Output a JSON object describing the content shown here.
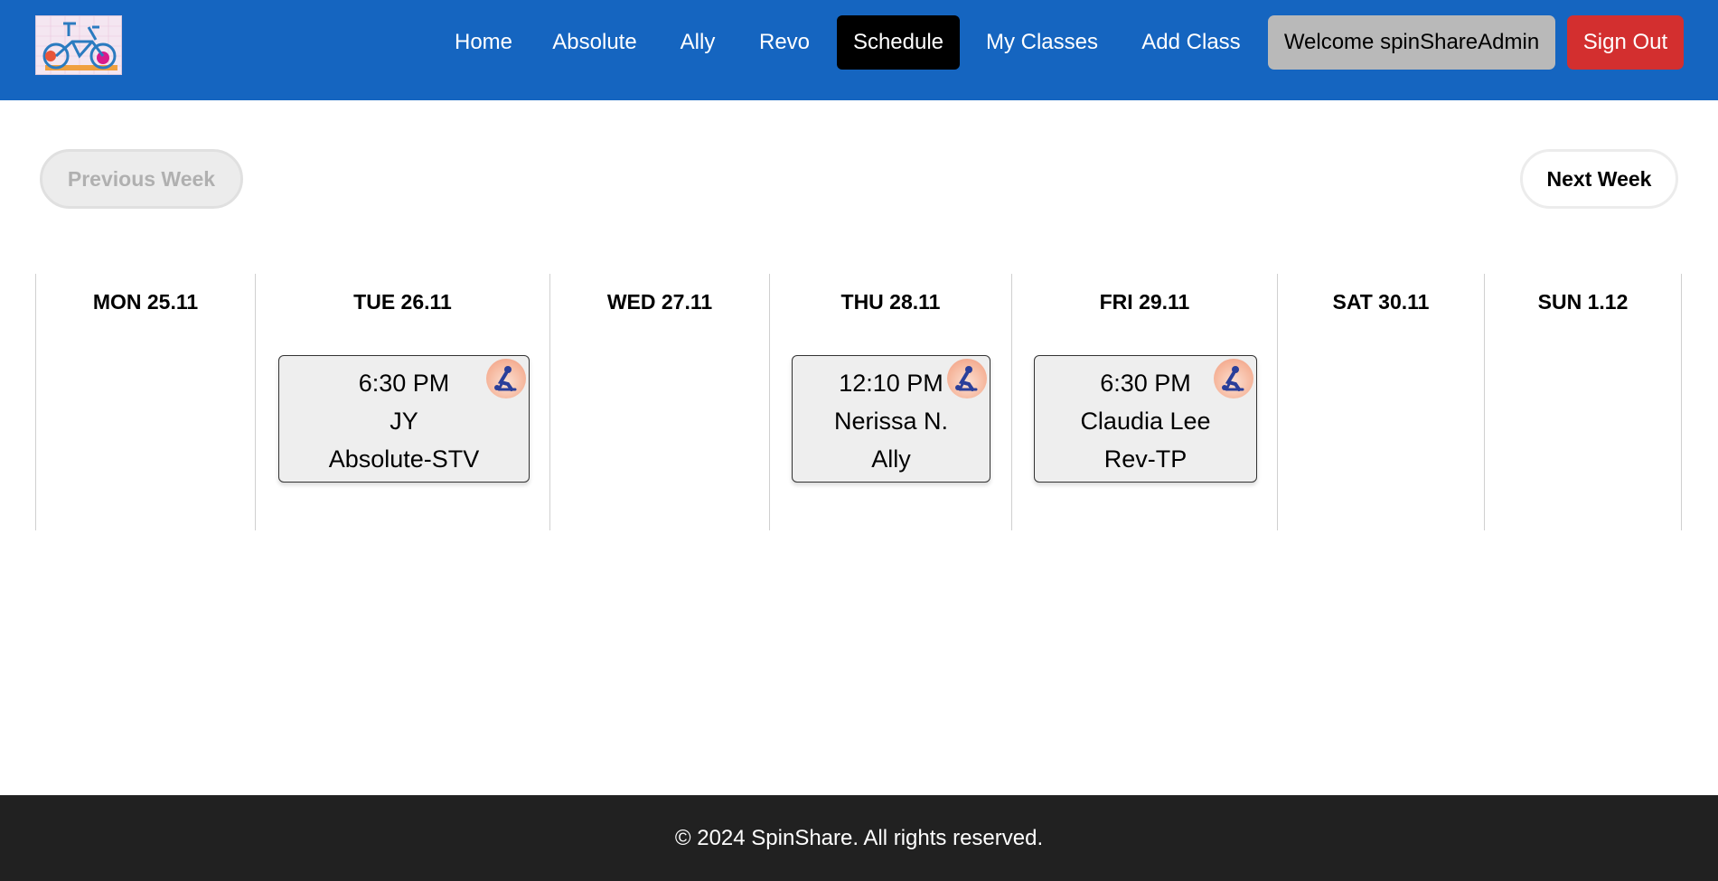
{
  "nav": {
    "logo_alt": "SpinShare logo",
    "items": [
      {
        "label": "Home"
      },
      {
        "label": "Absolute"
      },
      {
        "label": "Ally"
      },
      {
        "label": "Revo"
      },
      {
        "label": "Schedule",
        "active": true
      },
      {
        "label": "My Classes"
      },
      {
        "label": "Add Class"
      }
    ],
    "welcome": "Welcome spinShareAdmin",
    "signout": "Sign Out"
  },
  "week_nav": {
    "previous": "Previous Week",
    "next": "Next Week",
    "previous_disabled": true
  },
  "schedule": {
    "days": [
      {
        "label": "MON 25.11",
        "classes": []
      },
      {
        "label": "TUE 26.11",
        "classes": [
          {
            "time": "6:30 PM",
            "instructor": "JY",
            "studio": "Absolute-STV"
          }
        ]
      },
      {
        "label": "WED 27.11",
        "classes": []
      },
      {
        "label": "THU 28.11",
        "classes": [
          {
            "time": "12:10 PM",
            "instructor": "Nerissa N.",
            "studio": "Ally"
          }
        ]
      },
      {
        "label": "FRI 29.11",
        "classes": [
          {
            "time": "6:30 PM",
            "instructor": "Claudia Lee",
            "studio": "Rev-TP"
          }
        ]
      },
      {
        "label": "SAT 30.11",
        "classes": []
      },
      {
        "label": "SUN 1.12",
        "classes": []
      }
    ]
  },
  "footer": {
    "text": "© 2024 SpinShare. All rights reserved."
  },
  "colors": {
    "header_bg": "#1565c0",
    "active_nav_bg": "#000000",
    "welcome_bg": "#b9b9b9",
    "signout_bg": "#d32f2f",
    "footer_bg": "#212121",
    "card_bg": "#eeeeee"
  },
  "icons": {
    "logo": "bicycle-logo-icon",
    "class_badge": "spin-rider-icon"
  }
}
